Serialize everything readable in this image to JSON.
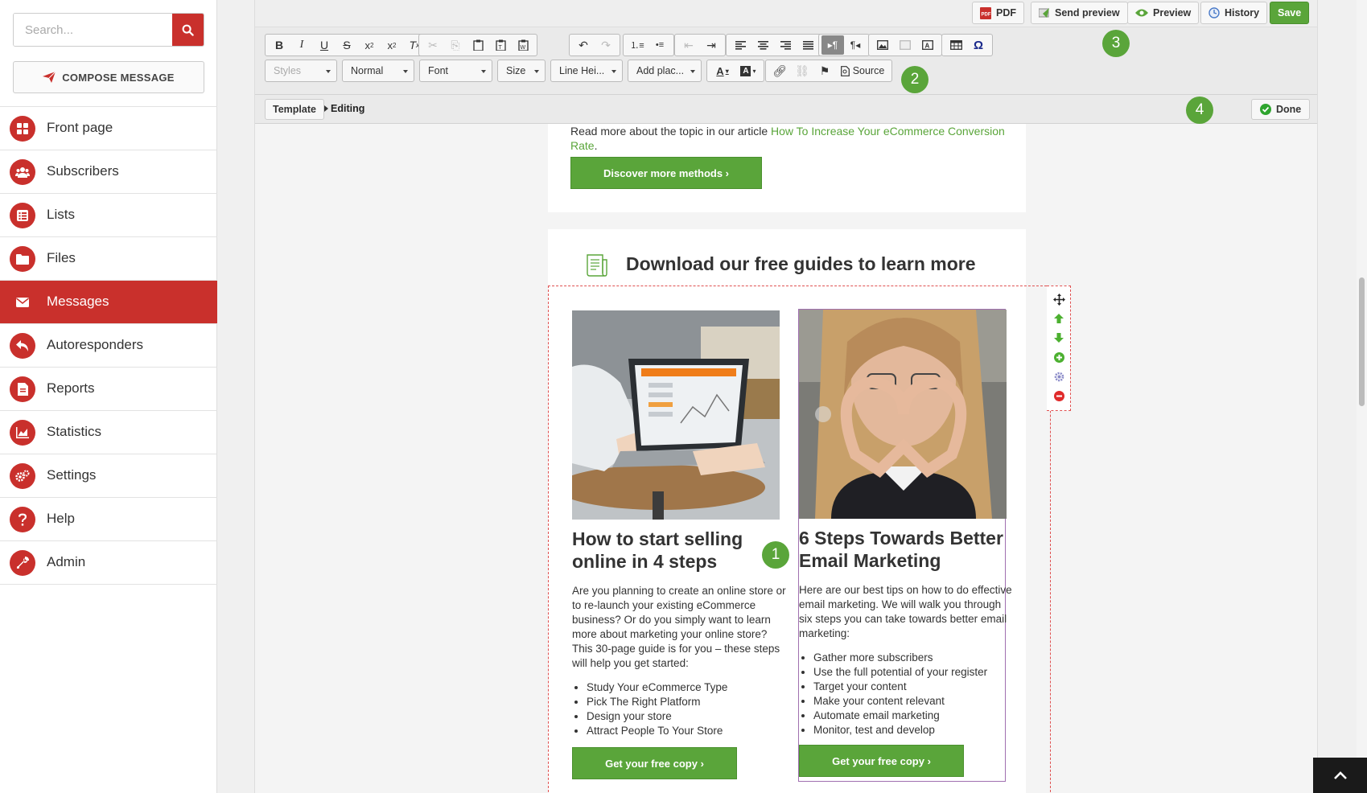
{
  "sidebar": {
    "search": {
      "placeholder": "Search..."
    },
    "compose_label": "COMPOSE MESSAGE",
    "items": [
      {
        "label": "Front page",
        "icon": "grid-icon"
      },
      {
        "label": "Subscribers",
        "icon": "users-icon"
      },
      {
        "label": "Lists",
        "icon": "list-icon"
      },
      {
        "label": "Files",
        "icon": "folder-icon"
      },
      {
        "label": "Messages",
        "icon": "envelope-icon",
        "active": true
      },
      {
        "label": "Autoresponders",
        "icon": "reply-icon"
      },
      {
        "label": "Reports",
        "icon": "report-icon"
      },
      {
        "label": "Statistics",
        "icon": "chart-icon"
      },
      {
        "label": "Settings",
        "icon": "gears-icon"
      },
      {
        "label": "Help",
        "icon": "question-icon"
      },
      {
        "label": "Admin",
        "icon": "wrench-icon"
      }
    ]
  },
  "topbar": {
    "pdf": "PDF",
    "send_preview": "Send preview",
    "preview": "Preview",
    "history": "History",
    "save": "Save"
  },
  "toolbar": {
    "styles": "Styles",
    "format": "Normal",
    "font": "Font",
    "size": "Size",
    "line_height": "Line Hei...",
    "placeholder": "Add plac...",
    "source": "Source"
  },
  "pathbar": {
    "template": "Template",
    "editing": "Editing",
    "done": "Done"
  },
  "badges": [
    "1",
    "2",
    "3",
    "4"
  ],
  "content": {
    "read_more_prefix": "Read more about the topic in our article ",
    "read_more_link": "How To Increase Your eCommerce Conversion Rate",
    "read_more_suffix": ".",
    "discover_button": "Discover more methods ›",
    "section_title": "Download our free guides to learn more",
    "guide1": {
      "title": "How to start selling online in 4 steps",
      "body": "Are you planning to create an online store or to re-launch your existing eCommerce business? Or do you simply want to learn more about marketing your online store? This 30-page guide is for you – these steps will help you get started:",
      "bullets": [
        "Study Your eCommerce Type",
        "Pick The Right Platform",
        "Design your store",
        "Attract People To Your Store"
      ],
      "button": "Get your free copy ›"
    },
    "guide2": {
      "title": "6 Steps Towards Better Email Marketing",
      "body": "Here are our best tips on how to do effective email marketing. We will walk you through six steps you can take towards better email marketing:",
      "bullets": [
        "Gather more subscribers",
        "Use the full potential of your register",
        "Target your content",
        "Make your content relevant",
        "Automate email marketing",
        "Monitor, test and develop"
      ],
      "button": "Get your free copy ›"
    }
  },
  "colors": {
    "brand_red": "#c9302c",
    "accent_green": "#5aa53a"
  }
}
